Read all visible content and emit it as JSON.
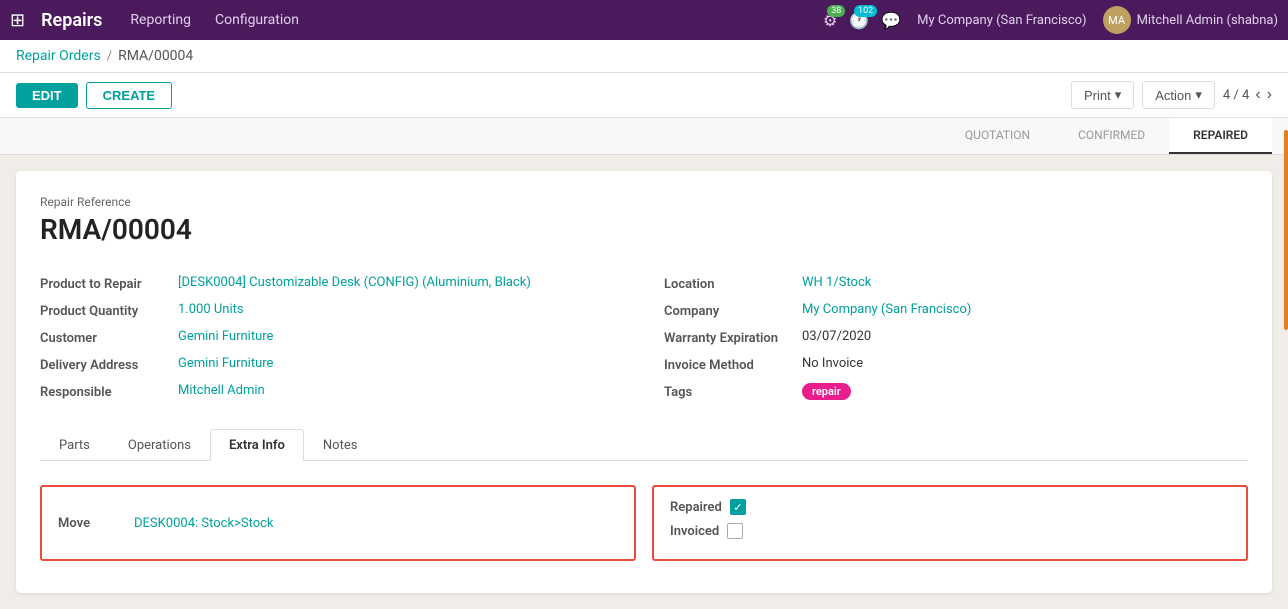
{
  "app": {
    "title": "Repairs",
    "nav_items": [
      "Reporting",
      "Configuration"
    ]
  },
  "nav_icons": {
    "bug_badge": "38",
    "chat_badge": "102"
  },
  "company": "My Company (San Francisco)",
  "user": "Mitchell Admin (shabna)",
  "breadcrumb": {
    "parent": "Repair Orders",
    "current": "RMA/00004"
  },
  "toolbar": {
    "edit_label": "EDIT",
    "create_label": "CREATE",
    "print_label": "Print",
    "action_label": "Action",
    "pagination": "4 / 4"
  },
  "status_steps": [
    {
      "label": "QUOTATION",
      "active": false
    },
    {
      "label": "CONFIRMED",
      "active": false
    },
    {
      "label": "REPAIRED",
      "active": true
    }
  ],
  "form": {
    "repair_ref_label": "Repair Reference",
    "repair_ref_value": "RMA/00004",
    "product_to_repair_label": "Product to Repair",
    "product_to_repair_value": "[DESK0004] Customizable Desk (CONFIG) (Aluminium, Black)",
    "product_quantity_label": "Product Quantity",
    "product_quantity_value": "1.000 Units",
    "customer_label": "Customer",
    "customer_value": "Gemini Furniture",
    "delivery_address_label": "Delivery Address",
    "delivery_address_value": "Gemini Furniture",
    "responsible_label": "Responsible",
    "responsible_value": "Mitchell Admin",
    "location_label": "Location",
    "location_value": "WH 1/Stock",
    "company_label": "Company",
    "company_value": "My Company (San Francisco)",
    "warranty_expiration_label": "Warranty Expiration",
    "warranty_expiration_value": "03/07/2020",
    "invoice_method_label": "Invoice Method",
    "invoice_method_value": "No Invoice",
    "tags_label": "Tags",
    "tags_value": "repair"
  },
  "tabs": [
    {
      "label": "Parts",
      "active": false
    },
    {
      "label": "Operations",
      "active": false
    },
    {
      "label": "Extra Info",
      "active": true
    },
    {
      "label": "Notes",
      "active": false
    }
  ],
  "extra_info": {
    "move_label": "Move",
    "move_value": "DESK0004: Stock>Stock",
    "repaired_label": "Repaired",
    "repaired_checked": true,
    "invoiced_label": "Invoiced",
    "invoiced_checked": false
  }
}
